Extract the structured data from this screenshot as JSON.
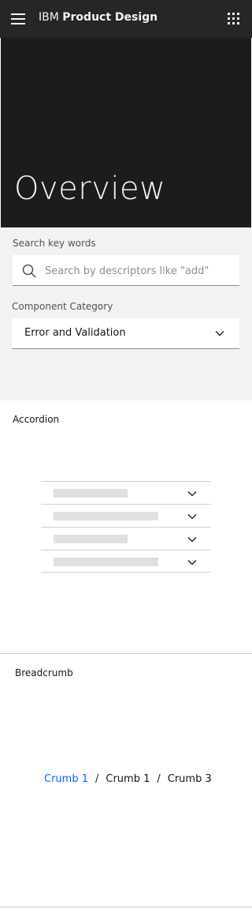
{
  "header": {
    "brand_prefix": "IBM",
    "brand_name": "Product Design",
    "menu_icon": "hamburger-menu-icon",
    "apps_icon": "app-switcher-grid-icon"
  },
  "hero": {
    "title": "Overview"
  },
  "filters": {
    "search_label": "Search key words",
    "search_placeholder": "Search by descriptors like \"add\"",
    "search_value": "",
    "search_icon": "search-icon",
    "category_label": "Component Category",
    "category_value": "Error and Validation",
    "category_icon": "chevron-down-icon"
  },
  "accordion": {
    "title": "Accordion",
    "items": [
      {
        "icon": "chevron-down-icon"
      },
      {
        "icon": "chevron-down-icon"
      },
      {
        "icon": "chevron-down-icon"
      },
      {
        "icon": "chevron-down-icon"
      }
    ]
  },
  "breadcrumb": {
    "title": "Breadcrumb",
    "separator": "/",
    "items": [
      "Crumb 1",
      "Crumb 1",
      "Crumb 3"
    ]
  },
  "colors": {
    "header_bg": "#262626",
    "hero_bg": "#1c1c1c",
    "filters_bg": "#f2f2f2",
    "link": "#0f62fe",
    "skeleton": "#e0e0e0"
  }
}
